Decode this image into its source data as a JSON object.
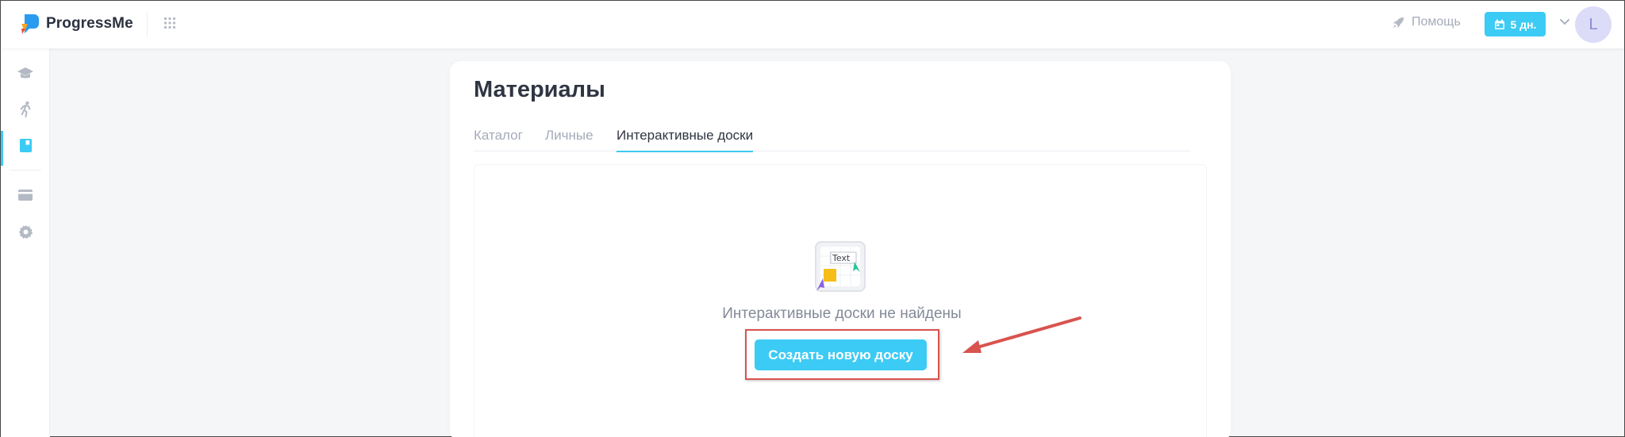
{
  "app": {
    "name": "ProgressMe"
  },
  "header": {
    "help_label": "Помощь",
    "days_badge": "5 дн.",
    "avatar_letter": "L"
  },
  "sidebar": {
    "items": [
      {
        "icon": "graduation-cap-icon"
      },
      {
        "icon": "running-person-icon"
      },
      {
        "icon": "book-icon",
        "active": true
      },
      {
        "icon": "credit-card-icon"
      },
      {
        "icon": "gear-icon"
      }
    ]
  },
  "page": {
    "title": "Материалы",
    "tabs": [
      {
        "label": "Каталог"
      },
      {
        "label": "Личные"
      },
      {
        "label": "Интерактивные доски",
        "active": true
      }
    ],
    "empty_icon_text": "Text",
    "empty_message": "Интерактивные доски не найдены",
    "create_button": "Создать новую доску"
  },
  "colors": {
    "accent": "#3ccbf4",
    "annotation": "#d9534f",
    "avatar_bg": "#dcdcf9"
  }
}
